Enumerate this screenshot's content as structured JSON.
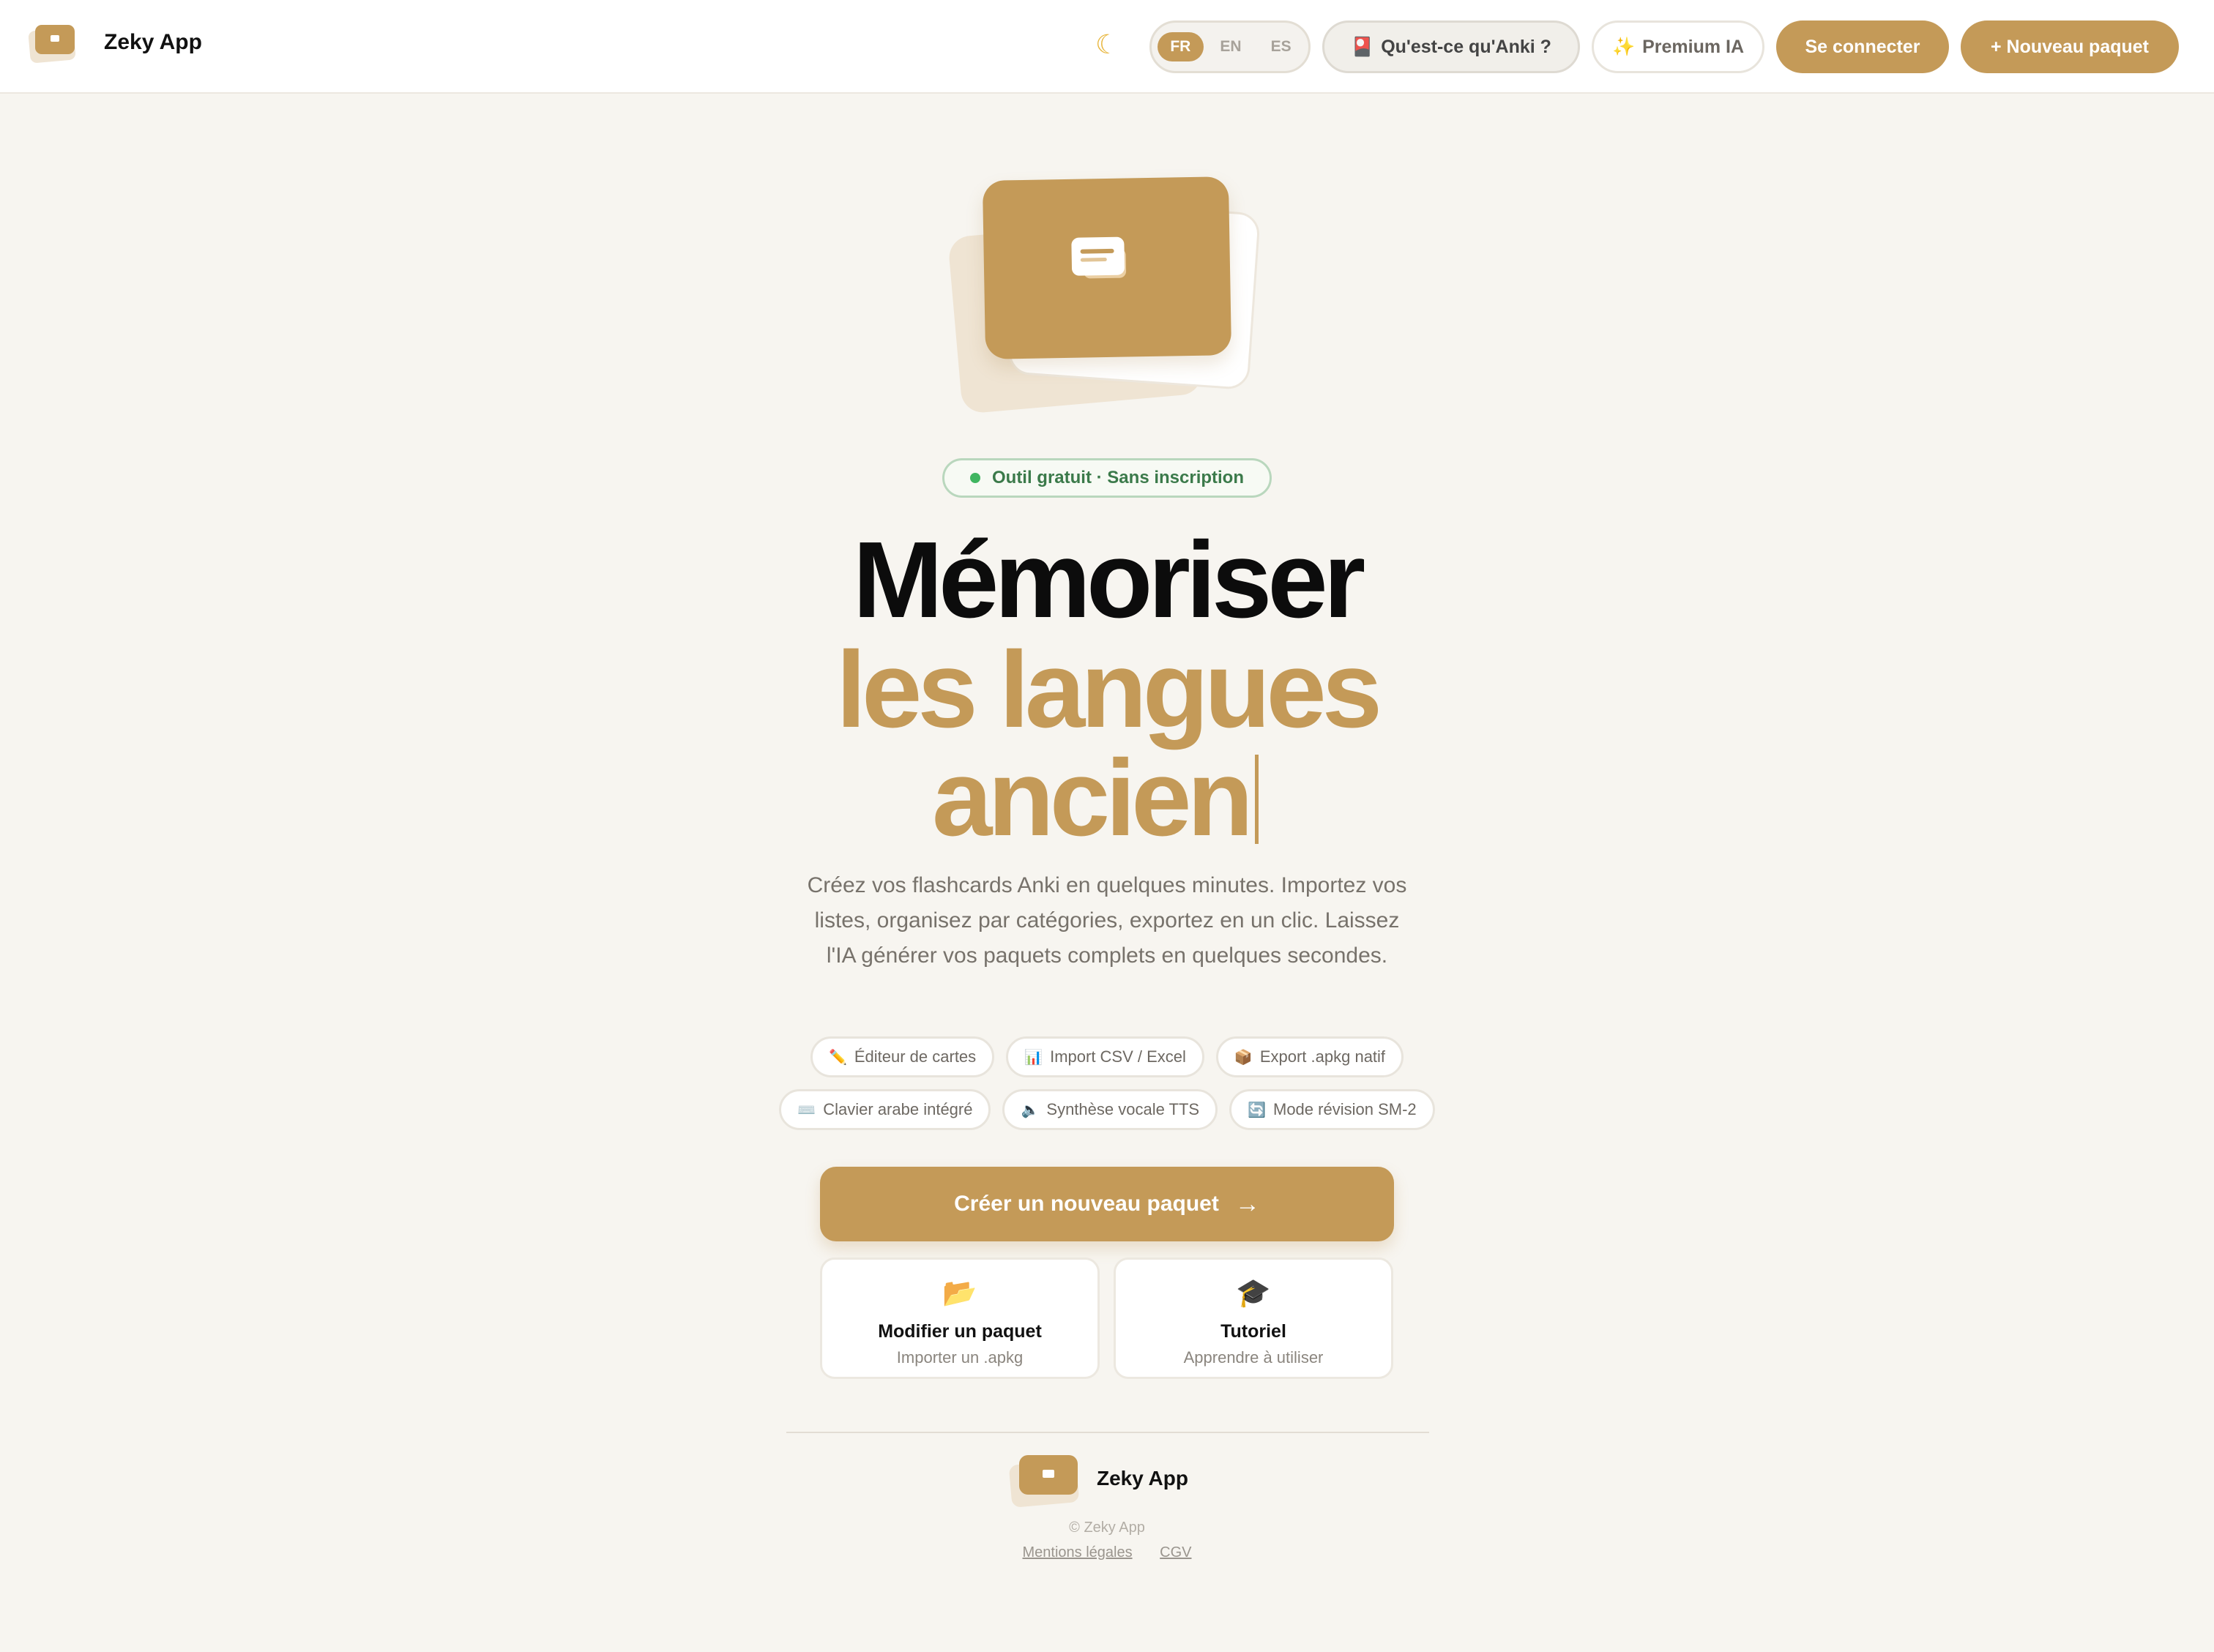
{
  "header": {
    "brand": "Zeky App",
    "theme_icon": "moon-icon",
    "languages": [
      "FR",
      "EN",
      "ES"
    ],
    "active_language": "FR",
    "anki_button": "Qu'est-ce qu'Anki ?",
    "anki_icon": "card-icon",
    "premium_button": "Premium IA",
    "premium_icon": "sparkles-icon",
    "login_button": "Se connecter",
    "new_deck_button": "+ Nouveau paquet"
  },
  "hero": {
    "badge": "Outil gratuit · Sans inscription",
    "title_line1": "Mémoriser",
    "title_line2": "les langues",
    "title_line3": "ancien",
    "description": "Créez vos flashcards Anki en quelques minutes. Importez vos listes, organisez par catégories, exportez en un clic. Laissez l'IA générer vos paquets complets en quelques secondes."
  },
  "features": [
    {
      "icon": "pencil-icon",
      "glyph": "✏️",
      "label": "Éditeur de cartes"
    },
    {
      "icon": "bar-chart-icon",
      "glyph": "📊",
      "label": "Import CSV / Excel"
    },
    {
      "icon": "package-icon",
      "glyph": "📦",
      "label": "Export .apkg natif"
    },
    {
      "icon": "keyboard-icon",
      "glyph": "⌨️",
      "label": "Clavier arabe intégré"
    },
    {
      "icon": "speaker-icon",
      "glyph": "🔈",
      "label": "Synthèse vocale TTS"
    },
    {
      "icon": "refresh-icon",
      "glyph": "🔄",
      "label": "Mode révision SM-2"
    }
  ],
  "actions": {
    "create_button": "Créer un nouveau paquet",
    "edit_card": {
      "icon": "folder-icon",
      "glyph": "📂",
      "title": "Modifier un paquet",
      "subtitle": "Importer un .apkg"
    },
    "tutorial_card": {
      "icon": "graduation-cap-icon",
      "glyph": "🎓",
      "title": "Tutoriel",
      "subtitle": "Apprendre à utiliser"
    }
  },
  "footer": {
    "brand": "Zeky App",
    "copyright": "© Zeky App",
    "links": [
      "Mentions légales",
      "CGV"
    ]
  },
  "colors": {
    "accent": "#c49a58",
    "background": "#f7f5f0",
    "badge_green": "#3fb560"
  }
}
